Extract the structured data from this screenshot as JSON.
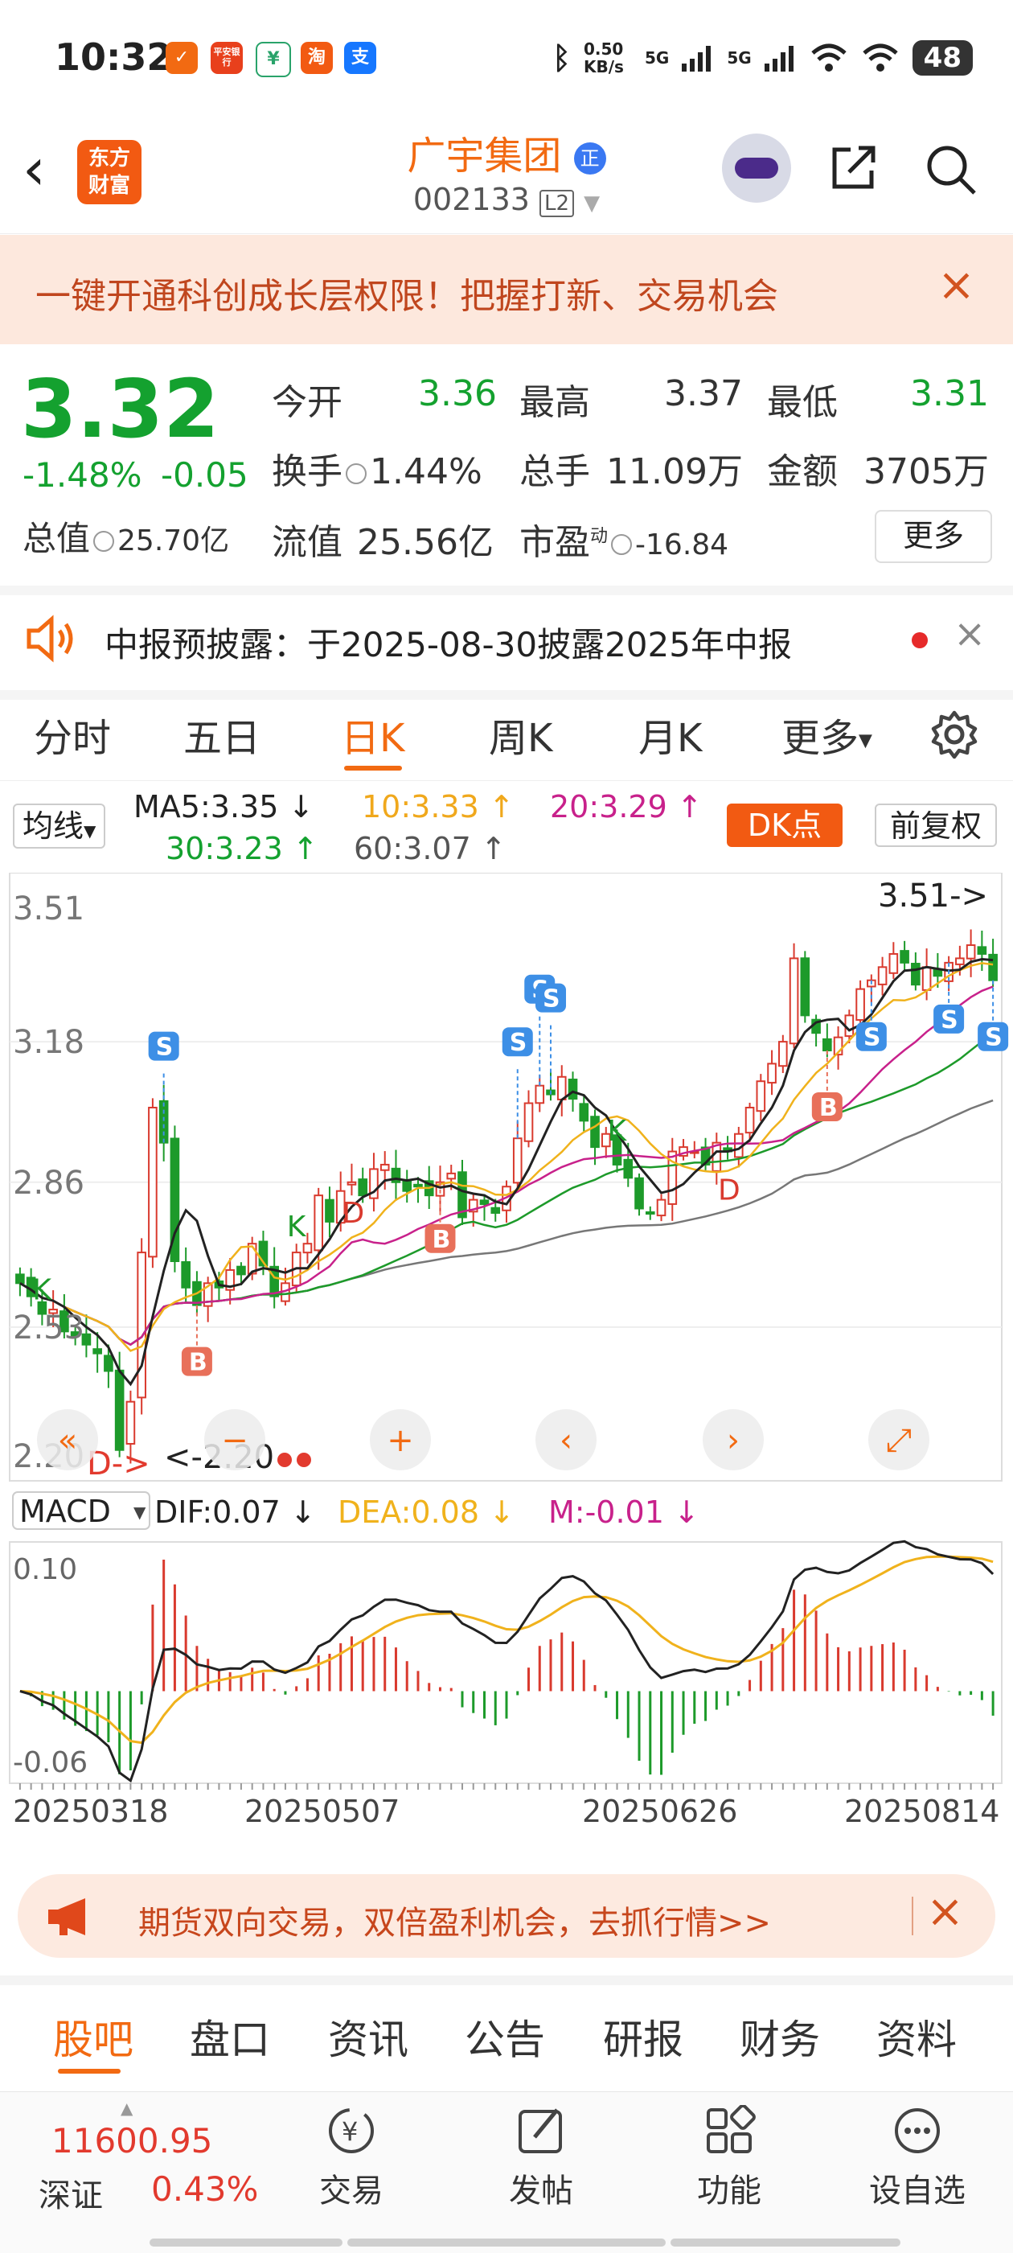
{
  "status_bar": {
    "time": "10:32",
    "net_speed": "0.50 KB/s",
    "sig1": "5G",
    "sig2": "5G",
    "battery": "48"
  },
  "status_apps": [
    "平安银行",
    "平安",
    "绿",
    "淘",
    "支"
  ],
  "header": {
    "stock_name": "广宇集团",
    "badge": "正",
    "code": "002133",
    "level": "L2",
    "logo_line1": "东方",
    "logo_line2": "财富"
  },
  "banner1": {
    "text": "一键开通科创成长层权限！把握打新、交易机会",
    "close": "×"
  },
  "quote": {
    "price": "3.32",
    "change_pct": "-1.48%",
    "change_amt": "-0.05",
    "total_cap_label": "总值",
    "total_cap": "25.70亿",
    "open_label": "今开",
    "open": "3.36",
    "high_label": "最高",
    "high": "3.37",
    "low_label": "最低",
    "low": "3.31",
    "turnover_label": "换手",
    "turnover": "1.44%",
    "volume_label": "总手",
    "volume": "11.09万",
    "amount_label": "金额",
    "amount": "3705万",
    "float_cap_label": "流值",
    "float_cap": "25.56亿",
    "pe_label": "市盈",
    "pe_sup": "动",
    "pe": "-16.84",
    "more": "更多"
  },
  "notice": {
    "text": "中报预披露：于2025-08-30披露2025年中报",
    "close": "×"
  },
  "kline_tabs": [
    "分时",
    "五日",
    "日K",
    "周K",
    "月K",
    "更多"
  ],
  "active_tab": "日K",
  "ma": {
    "select": "均线",
    "ma5": "MA5:3.35 ↓",
    "ma10": "10:3.33 ↑",
    "ma20": "20:3.29 ↑",
    "ma30": "30:3.23 ↑",
    "ma60": "60:3.07 ↑",
    "dk_button": "DK点",
    "fq_button": "前复权"
  },
  "chart_data": {
    "type": "candlestick",
    "title": "",
    "y_ticks": [
      "3.51",
      "3.18",
      "2.86",
      "2.53",
      "2.20"
    ],
    "ylim": [
      2.2,
      3.51
    ],
    "high_label": "3.51->",
    "low_label": "<-2.20",
    "low_prefix": "D->",
    "marker_labels": {
      "buy": "B",
      "sell": "S",
      "k": "K",
      "d": "D"
    },
    "ma_colors": {
      "ma5": "#222222",
      "ma10": "#f0b21c",
      "ma20": "#c8218b",
      "ma30": "#1d9a2a",
      "ma60": "#777777"
    },
    "close": [
      2.63,
      2.6,
      2.56,
      2.57,
      2.52,
      2.51,
      2.49,
      2.47,
      2.43,
      2.25,
      2.36,
      2.7,
      3.03,
      2.95,
      2.68,
      2.62,
      2.58,
      2.63,
      2.62,
      2.66,
      2.65,
      2.72,
      2.67,
      2.6,
      2.63,
      2.7,
      2.72,
      2.83,
      2.77,
      2.84,
      2.86,
      2.83,
      2.89,
      2.9,
      2.86,
      2.84,
      2.85,
      2.83,
      2.86,
      2.88,
      2.78,
      2.82,
      2.81,
      2.79,
      2.85,
      2.96,
      3.04,
      3.08,
      3.06,
      3.1,
      3.05,
      3.0,
      2.94,
      2.97,
      2.9,
      2.87,
      2.8,
      2.79,
      2.82,
      2.93,
      2.94,
      2.93,
      2.9,
      2.95,
      2.93,
      2.97,
      3.03,
      3.09,
      3.13,
      3.18,
      3.37,
      3.24,
      3.2,
      3.16,
      3.19,
      3.24,
      3.3,
      3.32,
      3.35,
      3.38,
      3.36,
      3.31,
      3.35,
      3.33,
      3.36,
      3.37,
      3.4,
      3.38,
      3.32
    ]
  },
  "macd": {
    "select": "MACD",
    "dif": "DIF:0.07 ↓",
    "dea": "DEA:0.08 ↓",
    "m": "M:-0.01 ↓",
    "y_top": "0.10",
    "y_bottom": "-0.06",
    "dates": [
      "20250318",
      "20250507",
      "20250626",
      "20250814"
    ]
  },
  "nav_controls": [
    "«",
    "−",
    "+",
    "‹",
    "›",
    "⤢"
  ],
  "banner2": {
    "text": "期货双向交易，双倍盈利机会，去抓行情>>",
    "close": "×"
  },
  "info_tabs": [
    "股吧",
    "盘口",
    "资讯",
    "公告",
    "研报",
    "财务",
    "资料"
  ],
  "active_info_tab": "股吧",
  "bottom_bar": {
    "index_value": "11600.95",
    "index_name": "深证",
    "index_pct": "0.43%",
    "items": [
      "交易",
      "发帖",
      "功能",
      "设自选"
    ]
  }
}
